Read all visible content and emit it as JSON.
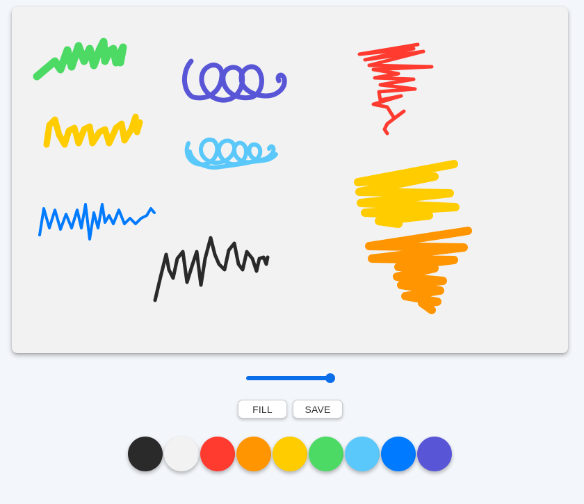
{
  "toolbar": {
    "fill_label": "FILL",
    "save_label": "SAVE"
  },
  "brush_size": {
    "value_fraction": 1.0
  },
  "palette": {
    "colors": [
      "#2a2a2a",
      "#f2f2f2",
      "#ff3b30",
      "#ff9500",
      "#ffcc00",
      "#4cd964",
      "#5ac8fa",
      "#007aff",
      "#5856d6"
    ],
    "names": [
      "black",
      "white",
      "red",
      "orange",
      "yellow",
      "green",
      "light-blue",
      "blue",
      "purple"
    ]
  },
  "canvas": {
    "background": "#f2f2f2"
  }
}
